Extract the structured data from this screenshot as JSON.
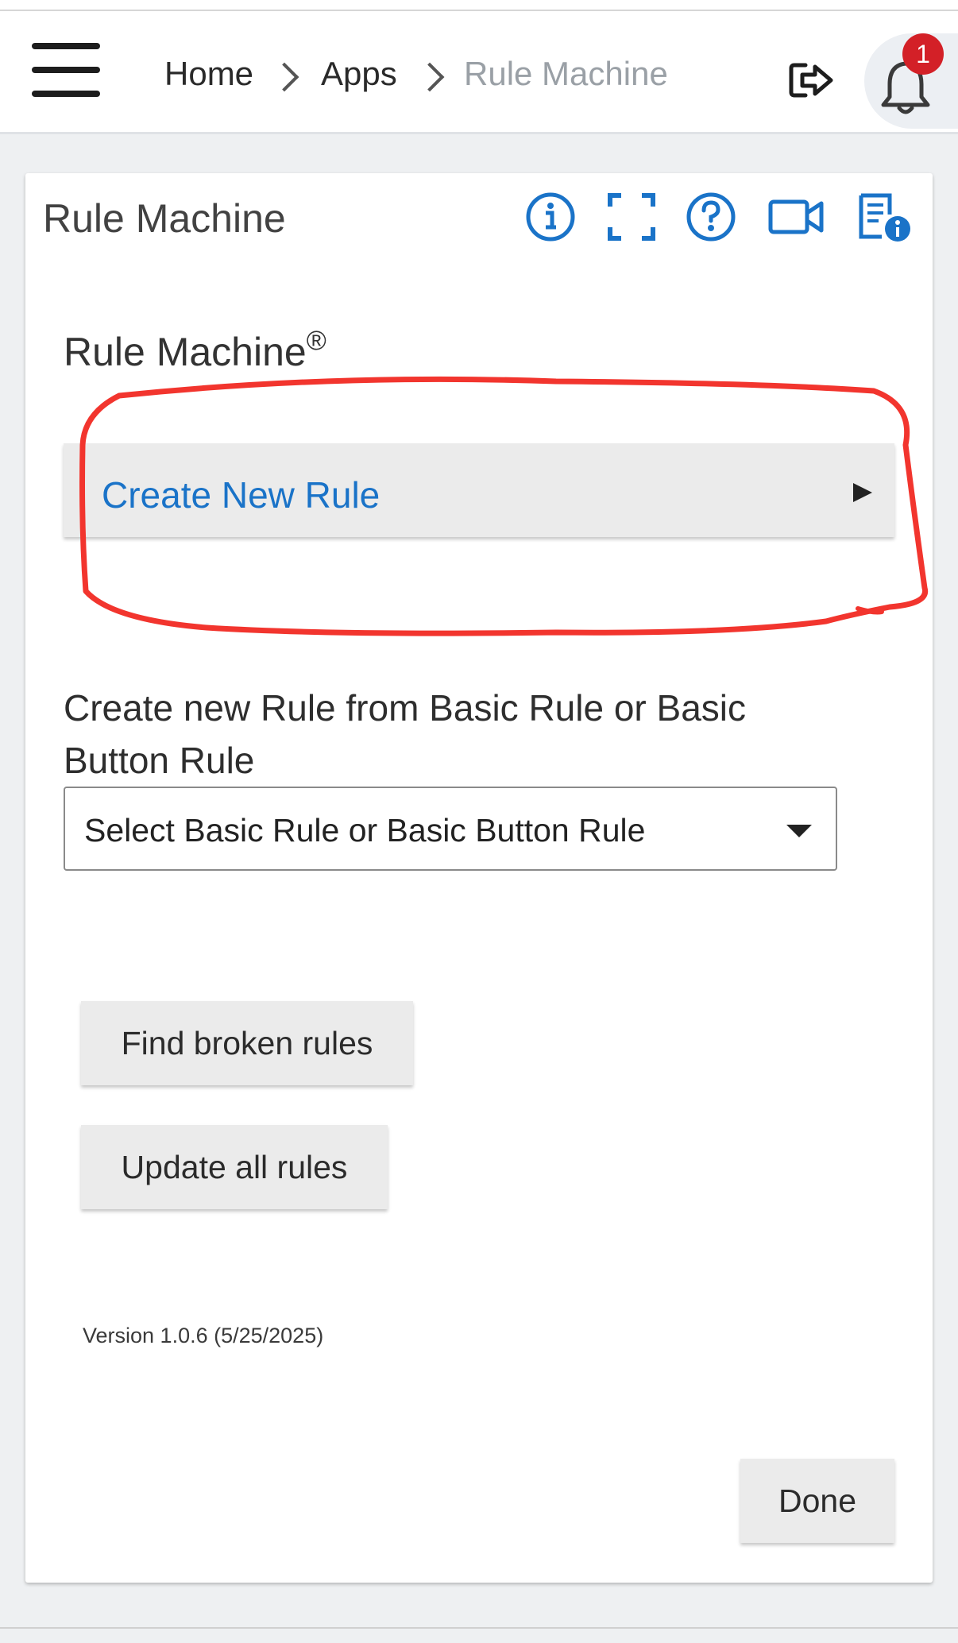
{
  "header": {
    "breadcrumb": {
      "home": "Home",
      "apps": "Apps",
      "current": "Rule Machine"
    },
    "notification_count": "1"
  },
  "card": {
    "title": "Rule Machine",
    "toolbar_icons": [
      "info-icon",
      "fullscreen-icon",
      "help-icon",
      "video-icon",
      "app-info-document-icon"
    ]
  },
  "content": {
    "section_title": "Rule Machine",
    "registered_mark": "®",
    "create_new_rule_label": "Create New Rule",
    "basic_rule_label": "Create new Rule from Basic Rule or Basic Button Rule",
    "basic_rule_select_value": "Select Basic Rule or Basic Button Rule",
    "find_broken_label": "Find broken rules",
    "update_all_label": "Update all rules",
    "version": "Version 1.0.6 (5/25/2025)",
    "done_label": "Done"
  },
  "colors": {
    "accent_blue": "#1a73c8",
    "badge_red": "#d32027",
    "annotation_red": "#f2352e"
  }
}
